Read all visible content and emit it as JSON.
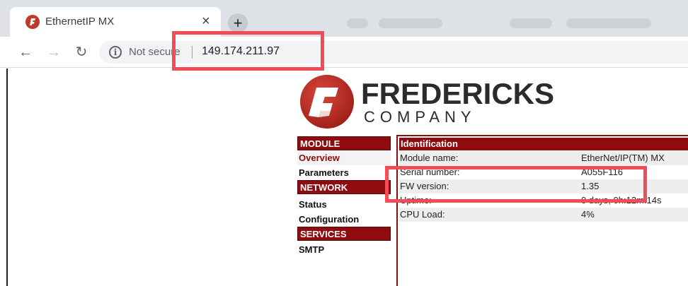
{
  "browser": {
    "tab": {
      "title": "EthernetIP MX",
      "close_glyph": "×",
      "favicon": "fredericks-logo-icon"
    },
    "new_tab_glyph": "+",
    "nav": {
      "back": "←",
      "forward": "→",
      "reload": "↻"
    },
    "omnibox": {
      "info_glyph": "i",
      "security": "Not secure",
      "url": "149.174.211.97"
    }
  },
  "brand": {
    "name_line1": "FREDERICKS",
    "name_line2": "COMPANY",
    "accent_color": "#8e0c0e"
  },
  "sidebar": {
    "sections": [
      {
        "heading": "MODULE",
        "items": [
          "Overview",
          "Parameters"
        ]
      },
      {
        "heading": "NETWORK",
        "items": [
          "Status",
          "Configuration"
        ]
      },
      {
        "heading": "SERVICES",
        "items": [
          "SMTP"
        ]
      }
    ]
  },
  "identification": {
    "heading": "Identification",
    "rows": [
      {
        "label": "Module name:",
        "value": "EtherNet/IP(TM) MX"
      },
      {
        "label": "Serial number:",
        "value": "A055F116"
      },
      {
        "label": "FW version:",
        "value": "1.35"
      },
      {
        "label": "Uptime:",
        "value": "0 days, 0h:12m:14s"
      },
      {
        "label": "CPU Load:",
        "value": "4%"
      }
    ]
  },
  "annotation_color": "#f24d57"
}
